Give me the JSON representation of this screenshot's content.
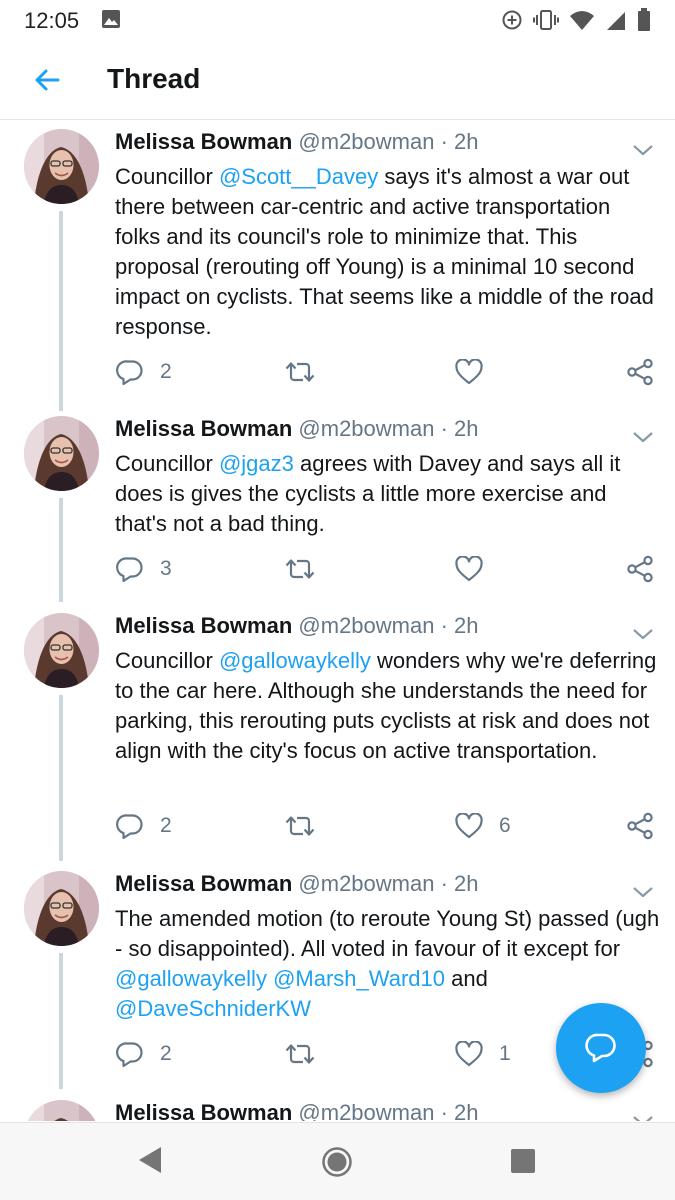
{
  "status_bar": {
    "time": "12:05"
  },
  "header": {
    "title": "Thread"
  },
  "tweets": [
    {
      "name": "Melissa Bowman",
      "handle": "@m2bowman",
      "dot": "·",
      "time": "2h",
      "segments": [
        "Councillor ",
        "@Scott__Davey",
        " says it's almost a war out there between car-centric and active transportation folks and its council's role to minimize that. This proposal (rerouting off Young) is a minimal 10 second impact on cyclists. That seems like a middle of the road response."
      ],
      "replies": "2",
      "retweets": "",
      "likes": ""
    },
    {
      "name": "Melissa Bowman",
      "handle": "@m2bowman",
      "dot": "·",
      "time": "2h",
      "segments": [
        "Councillor ",
        "@jgaz3",
        " agrees with Davey and says all it does is gives the cyclists a little more exercise and that's not a bad thing."
      ],
      "replies": "3",
      "retweets": "",
      "likes": ""
    },
    {
      "name": "Melissa Bowman",
      "handle": "@m2bowman",
      "dot": "·",
      "time": "2h",
      "segments": [
        "Councillor ",
        "@gallowaykelly",
        " wonders why we're deferring to the car here. Although she understands the need for parking, this rerouting puts cyclists at risk and does not align with the city's focus on active transportation."
      ],
      "replies": "2",
      "retweets": "",
      "likes": "6"
    },
    {
      "name": "Melissa Bowman",
      "handle": "@m2bowman",
      "dot": "·",
      "time": "2h",
      "segments": [
        "The amended motion (to reroute Young St) passed (ugh - so disappointed). All voted in favour of it except for ",
        "@gallowaykelly",
        " ",
        "@Marsh_Ward10",
        " and ",
        "@DaveSchniderKW"
      ],
      "replies": "2",
      "retweets": "",
      "likes": "1"
    },
    {
      "name": "Melissa Bowman",
      "handle": "@m2bowman",
      "dot": "·",
      "time": "2h"
    }
  ],
  "colors": {
    "accent": "#1da1f2",
    "text": "#14171a",
    "secondary": "#657786",
    "thread_line": "#ccd6dd"
  },
  "icons": {
    "status": [
      "gallery-icon",
      "data-saver-icon",
      "vibrate-icon",
      "wifi-icon",
      "signal-icon",
      "battery-icon"
    ],
    "tweet_actions": [
      "reply-icon",
      "retweet-icon",
      "like-icon",
      "share-icon"
    ],
    "navigation": [
      "back-triangle-icon",
      "home-circle-icon",
      "recents-square-icon"
    ],
    "fab": "compose-reply-icon"
  }
}
